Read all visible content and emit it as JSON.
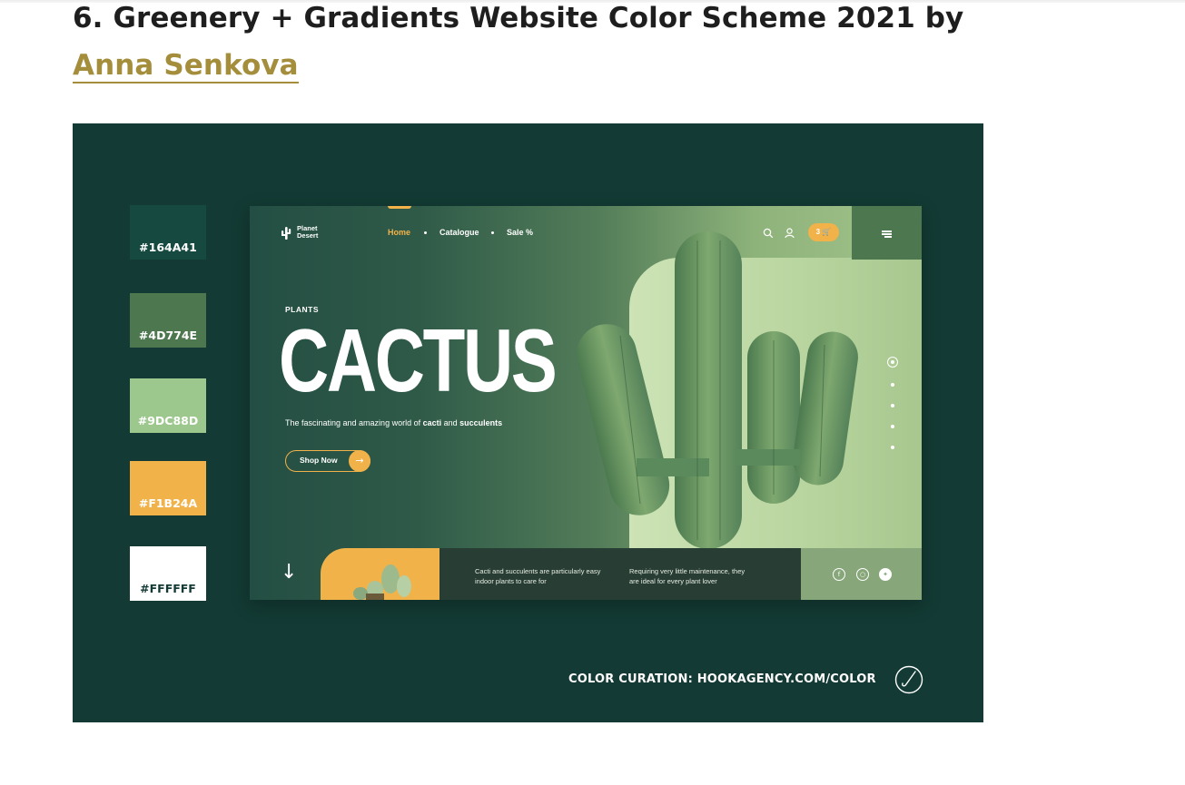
{
  "article": {
    "heading_prefix": "6. Greenery + Gradients Website Color Scheme 2021 by ",
    "author_link": "Anna Senkova"
  },
  "colors": {
    "heading_text": "#1e1e1e",
    "link": "#a48d3b",
    "figure_bg": "#133a34"
  },
  "palette": [
    {
      "label": "#164A41",
      "hex": "#164A41"
    },
    {
      "label": "#4D774E",
      "hex": "#4D774E"
    },
    {
      "label": "#9DC88D",
      "hex": "#9DC88D"
    },
    {
      "label": "#F1B24A",
      "hex": "#F1B24A"
    },
    {
      "label": "#FFFFFF",
      "hex": "#FFFFFF"
    }
  ],
  "mockup": {
    "logo": "Planet Desert",
    "nav": [
      "Home",
      "Catalogue",
      "Sale %"
    ],
    "cart_count": "3",
    "eyebrow": "PLANTS",
    "title": "CACTUS",
    "tagline_prefix": "The fascinating and amazing world of ",
    "tagline_bold_1": "cacti",
    "tagline_mid": " and ",
    "tagline_bold_2": "succulents",
    "cta": "Shop Now",
    "strip_text_1": "Cacti and succulents are particularly easy indoor plants to care for",
    "strip_text_2": "Requiring very little maintenance, they are ideal for every plant lover",
    "icons": [
      "search-icon",
      "user-icon",
      "cart-icon",
      "menu-icon",
      "arrow-down-icon",
      "facebook-icon",
      "instagram-icon",
      "twitter-icon"
    ]
  },
  "footer": {
    "curation": "COLOR CURATION: HOOKAGENCY.COM/COLOR"
  }
}
